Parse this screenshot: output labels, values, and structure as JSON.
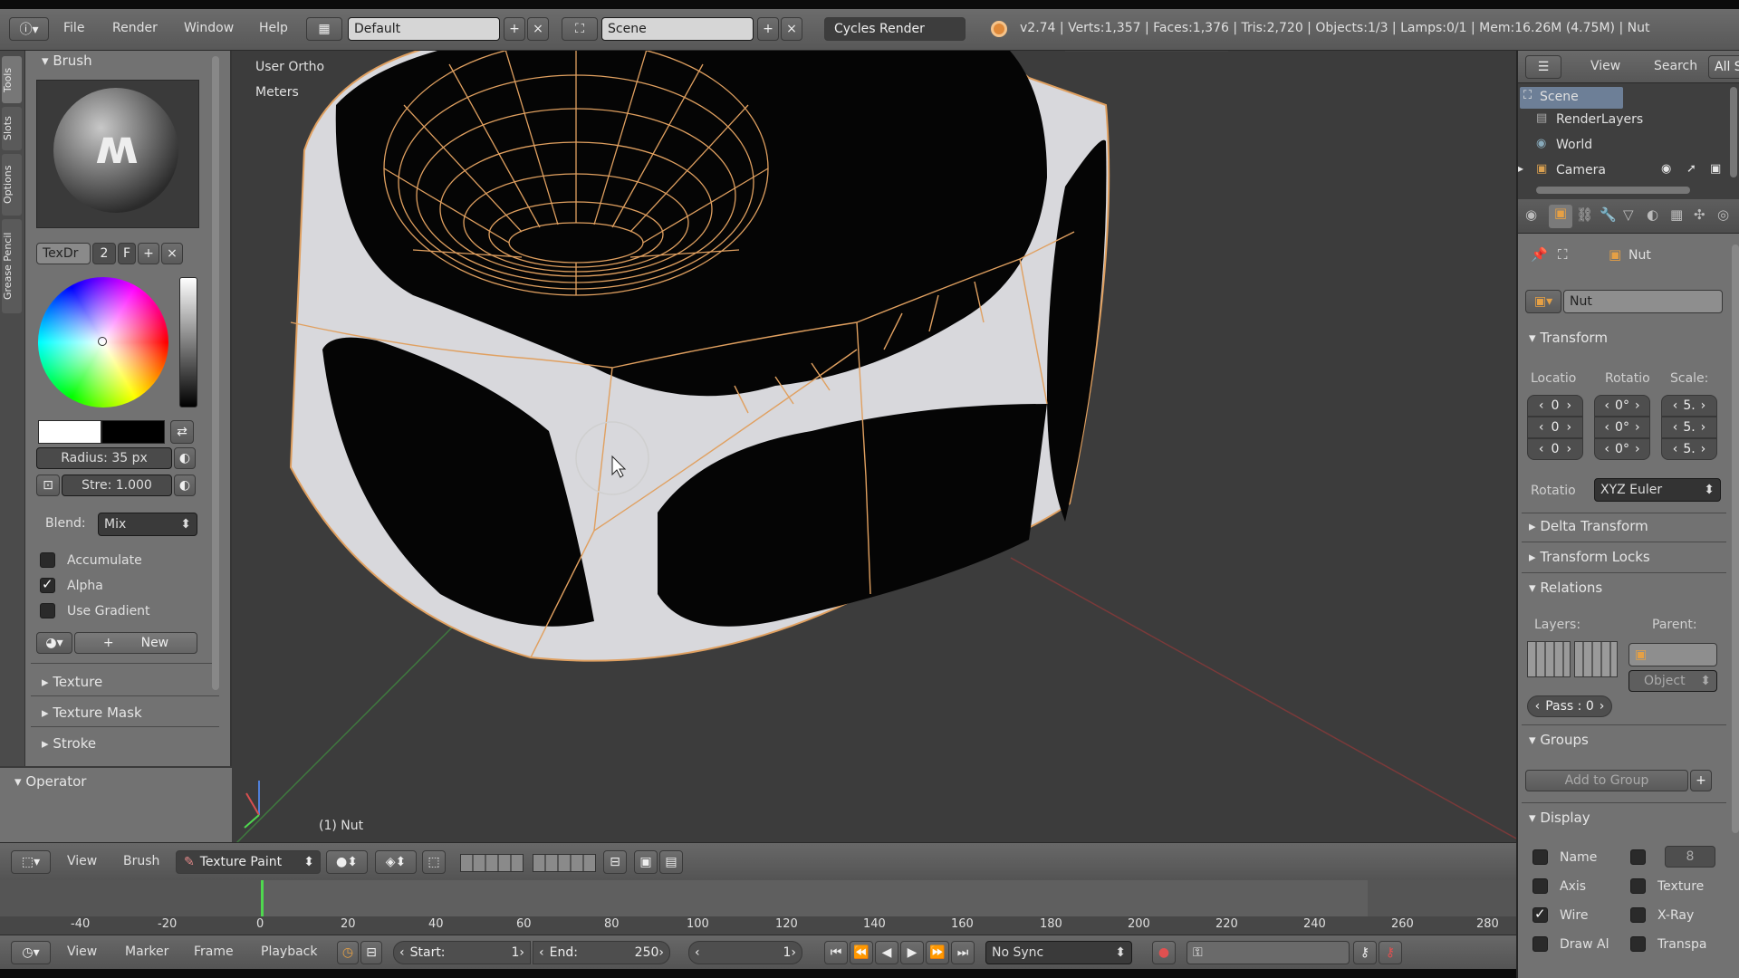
{
  "topbar": {
    "menus": [
      "File",
      "Render",
      "Window",
      "Help"
    ],
    "layout_name": "Default",
    "scene_name": "Scene",
    "engine": "Cycles Render",
    "stats": "v2.74 | Verts:1,357 | Faces:1,376 | Tris:2,720 | Objects:1/3 | Lamps:0/1 | Mem:16.26M (4.75M) | Nut"
  },
  "tabstrip": [
    "Tools",
    "Slots",
    "Options",
    "Grease Pencil"
  ],
  "toolshelf": {
    "brush_header": "Brush",
    "brush_name": "TexDr",
    "brush_users": "2",
    "brush_fake": "F",
    "radius": "Radius:   35 px",
    "strength": "Stre: 1.000",
    "blend_label": "Blend:",
    "blend_value": "Mix",
    "accumulate": "Accumulate",
    "alpha": "Alpha",
    "use_gradient": "Use Gradient",
    "new_label": "New",
    "sections": [
      "Texture",
      "Texture Mask",
      "Stroke"
    ],
    "operator": "Operator"
  },
  "viewport": {
    "view_name": "User Ortho",
    "units": "Meters",
    "object_label": "(1) Nut"
  },
  "outliner": {
    "tabs": [
      "View",
      "Search",
      "All S"
    ],
    "items": [
      "Scene",
      "RenderLayers",
      "World",
      "Camera"
    ]
  },
  "properties": {
    "object_name": "Nut",
    "object_field": "Nut",
    "transform": "Transform",
    "col_location": "Locatio",
    "col_rotation": "Rotatio",
    "col_scale": "Scale:",
    "loc_values": [
      "0",
      "0",
      "0"
    ],
    "rot_values": [
      "0°",
      "0°",
      "0°"
    ],
    "scale_values": [
      "5.",
      "5.",
      "5."
    ],
    "rotation_mode_label": "Rotatio",
    "rotation_mode": "XYZ Euler",
    "delta_transform": "Delta Transform",
    "transform_locks": "Transform Locks",
    "relations": "Relations",
    "layers_label": "Layers:",
    "parent_label": "Parent:",
    "parent_type": "Object",
    "pass_index": "Pass : 0",
    "groups": "Groups",
    "add_to_group": "Add to Group",
    "display": "Display",
    "display_left": [
      "Name",
      "Axis",
      "Wire",
      "Draw Al"
    ],
    "display_right": [
      "",
      "Texture",
      "X-Ray",
      "Transpa"
    ],
    "display_extra": "8"
  },
  "viewheader": {
    "view": "View",
    "brush": "Brush",
    "mode": "Texture Paint"
  },
  "timeline": {
    "ticks": [
      "-40",
      "-20",
      "0",
      "20",
      "40",
      "60",
      "80",
      "100",
      "120",
      "140",
      "160",
      "180",
      "200",
      "220",
      "240",
      "260",
      "280"
    ]
  },
  "timelineheader": {
    "menus": [
      "View",
      "Marker",
      "Frame",
      "Playback"
    ],
    "start": "Start:",
    "start_value": "1",
    "end": "End:",
    "end_value": "250",
    "current": "1",
    "sync": "No Sync"
  },
  "colors": {
    "wire": "#e0a060",
    "viewport_bg": "#3c3c3c",
    "panel_bg": "#727272"
  }
}
